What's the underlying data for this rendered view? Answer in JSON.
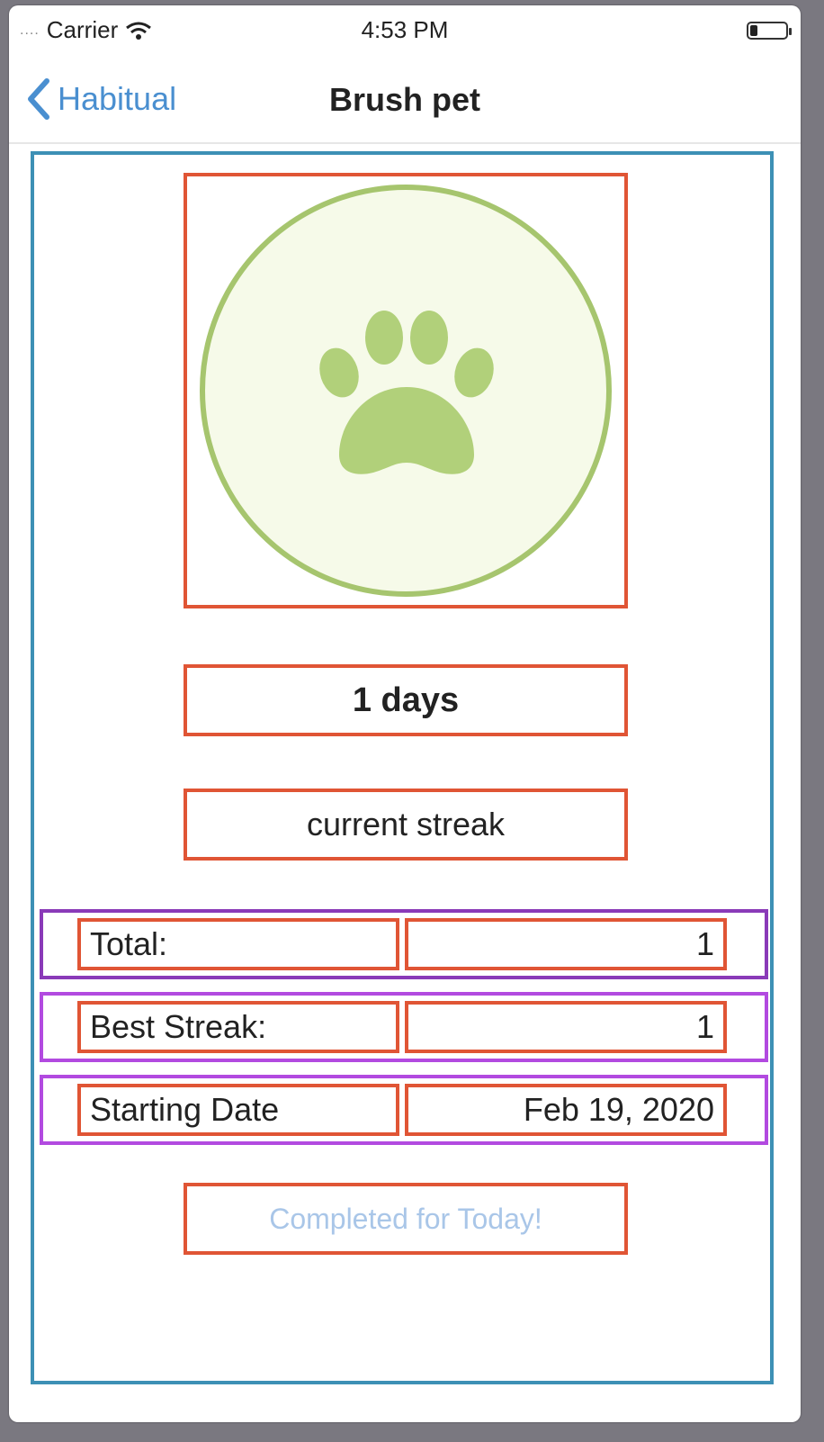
{
  "status_bar": {
    "signal": "....",
    "carrier": "Carrier",
    "time": "4:53 PM",
    "battery_level": 0.2
  },
  "nav": {
    "back_label": "Habitual",
    "title": "Brush pet"
  },
  "habit": {
    "icon": "paw-icon",
    "icon_color": "#b1d07a",
    "ring_color": "#a6c56e",
    "days": "1 days",
    "streak_caption": "current streak",
    "stats": [
      {
        "label": "Total:",
        "value": "1"
      },
      {
        "label": "Best Streak:",
        "value": "1"
      },
      {
        "label": "Starting Date",
        "value": "Feb 19, 2020"
      }
    ],
    "action": "Completed for Today!"
  }
}
